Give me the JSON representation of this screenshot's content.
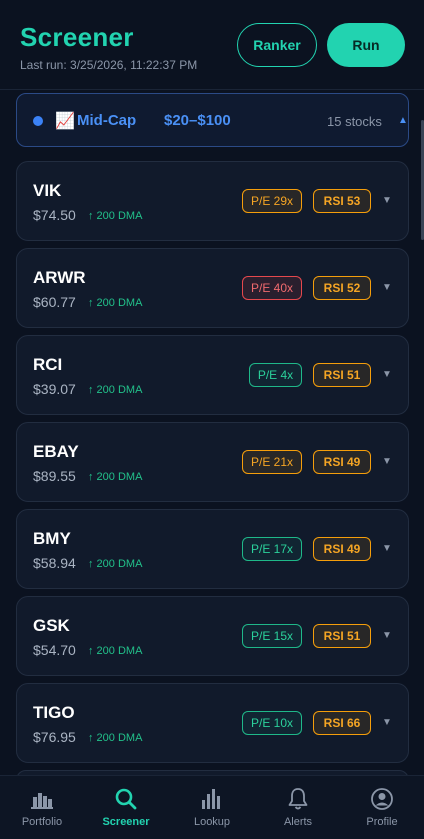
{
  "header": {
    "title": "Screener",
    "last_run": "Last run: 3/25/2026, 11:22:37 PM",
    "ranker_label": "Ranker",
    "run_label": "Run"
  },
  "group": {
    "emoji": "📈",
    "label": "Mid-Cap",
    "range": "$20–$100",
    "count": "15 stocks",
    "caret": "▲",
    "dot_color": "#3b82f6"
  },
  "stocks": [
    {
      "ticker": "VIK",
      "price": "$74.50",
      "dma": "↑ 200 DMA",
      "pe": "P/E 29x",
      "pe_tone": "orange",
      "rsi": "RSI 53",
      "caret": "▼"
    },
    {
      "ticker": "ARWR",
      "price": "$60.77",
      "dma": "↑ 200 DMA",
      "pe": "P/E 40x",
      "pe_tone": "red",
      "rsi": "RSI 52",
      "caret": "▼"
    },
    {
      "ticker": "RCI",
      "price": "$39.07",
      "dma": "↑ 200 DMA",
      "pe": "P/E 4x",
      "pe_tone": "green",
      "rsi": "RSI 51",
      "caret": "▼"
    },
    {
      "ticker": "EBAY",
      "price": "$89.55",
      "dma": "↑ 200 DMA",
      "pe": "P/E 21x",
      "pe_tone": "orange",
      "rsi": "RSI 49",
      "caret": "▼"
    },
    {
      "ticker": "BMY",
      "price": "$58.94",
      "dma": "↑ 200 DMA",
      "pe": "P/E 17x",
      "pe_tone": "green",
      "rsi": "RSI 49",
      "caret": "▼"
    },
    {
      "ticker": "GSK",
      "price": "$54.70",
      "dma": "↑ 200 DMA",
      "pe": "P/E 15x",
      "pe_tone": "green",
      "rsi": "RSI 51",
      "caret": "▼"
    },
    {
      "ticker": "TIGO",
      "price": "$76.95",
      "dma": "↑ 200 DMA",
      "pe": "P/E 10x",
      "pe_tone": "green",
      "rsi": "RSI 66",
      "caret": "▼"
    }
  ],
  "nav": {
    "items": [
      {
        "label": "Portfolio",
        "icon": "bar-chart-icon"
      },
      {
        "label": "Screener",
        "icon": "search-icon"
      },
      {
        "label": "Lookup",
        "icon": "columns-chart-icon"
      },
      {
        "label": "Alerts",
        "icon": "bell-icon"
      },
      {
        "label": "Profile",
        "icon": "user-circle-icon"
      }
    ],
    "active": "Screener"
  },
  "colors": {
    "accent": "#22d3b0",
    "background": "#0b1220",
    "group_blue": "#4a90f5",
    "pe_orange": "#f5a524",
    "pe_red": "#f06a6e",
    "pe_green": "#2bd19b"
  }
}
